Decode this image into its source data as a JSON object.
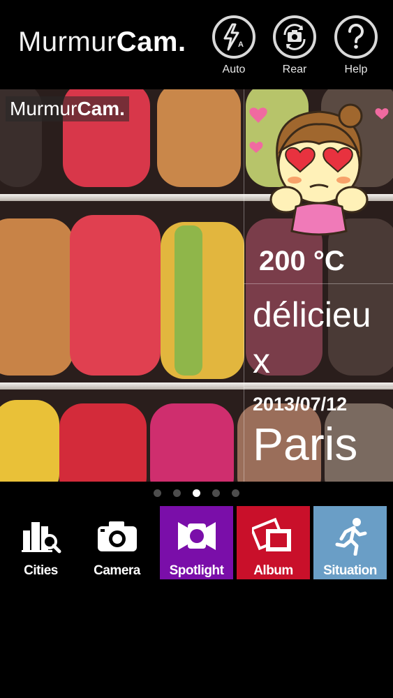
{
  "header": {
    "logo_light": "Murmur",
    "logo_bold": "Cam.",
    "buttons": {
      "flash_label": "Auto",
      "camera_label": "Rear",
      "help_label": "Help"
    }
  },
  "photo": {
    "watermark_light": "Murmur",
    "watermark_bold": "Cam.",
    "overlay": {
      "temperature": "200 °C",
      "feeling": "délicieux",
      "date": "2013/07/12",
      "city": "Paris"
    }
  },
  "pager": {
    "count": 5,
    "active_index": 2
  },
  "menu": {
    "cities": "Cities",
    "camera": "Camera",
    "spotlight": "Spotlight",
    "album": "Album",
    "situation": "Situation"
  },
  "colors": {
    "spotlight_bg": "#7a0ea9",
    "album_bg": "#c9102a",
    "situation_bg": "#6a9ec6"
  }
}
